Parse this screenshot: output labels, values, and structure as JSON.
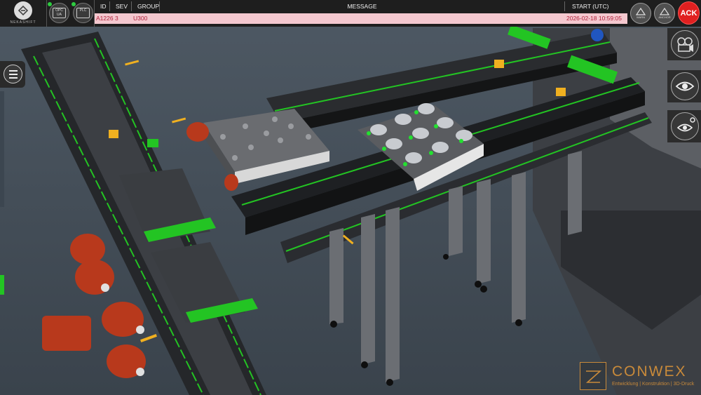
{
  "app": {
    "logo_text": "NEKASHIFT"
  },
  "toolbar": {
    "btn1_label": "OPC UA",
    "btn2_label": "PLC",
    "status_color": "#2ecc40"
  },
  "alarm_table": {
    "headers": {
      "id": "ID",
      "sev": "SEV",
      "group": "GROUP",
      "message": "MESSAGE",
      "start": "START (UTC)"
    },
    "row": {
      "id": "A1226",
      "sev": "3",
      "group": "U300",
      "message": "",
      "start": "2026-02-18 10:59:05"
    },
    "row_bg": "#f4c8cf",
    "row_text_color": "#b0203a"
  },
  "right_buttons": {
    "warn_small": "WARN",
    "anchor_small": "ANCHOR",
    "ack": "ACK"
  },
  "side_panel": {
    "camera_icon": "camera-icon",
    "eye_icon": "eye-icon",
    "eye_settings_icon": "eye-settings-icon"
  },
  "brand": {
    "name": "CONWEX",
    "tagline": "Entwicklung | Konstruktion | 3D-Druck",
    "color": "#c98a3a"
  },
  "colors": {
    "accent_green": "#23c423",
    "ack_red": "#e02020"
  }
}
